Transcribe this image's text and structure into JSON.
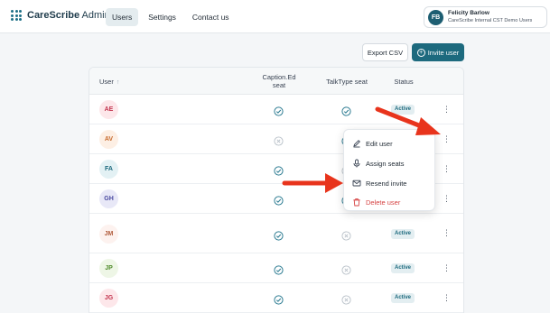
{
  "app": {
    "name": "CareScribe",
    "suffix": " Admin"
  },
  "nav": [
    {
      "label": "Users",
      "active": true
    },
    {
      "label": "Settings",
      "active": false
    },
    {
      "label": "Contact us",
      "active": false
    }
  ],
  "user": {
    "initials": "FB",
    "name": "Felicity Barlow",
    "org": "CareScribe Internal CST Demo Users"
  },
  "actions": {
    "export_label": "Export CSV",
    "invite_label": "Invite user"
  },
  "table": {
    "columns": {
      "user": "User",
      "captioned": "Caption.Ed\nseat",
      "talktype": "TalkType seat",
      "status": "Status"
    },
    "rows": [
      {
        "initials": "AE",
        "bg": "#fde7ea",
        "fg": "#c2334d",
        "captioned": true,
        "talktype": true,
        "status": "Active"
      },
      {
        "initials": "AV",
        "bg": "#fdefe4",
        "fg": "#c76a2d",
        "captioned": false,
        "talktype": true,
        "status": ""
      },
      {
        "initials": "FA",
        "bg": "#e3f1f4",
        "fg": "#1d6a7e",
        "captioned": true,
        "talktype": false,
        "status": ""
      },
      {
        "initials": "GH",
        "bg": "#e8e8f7",
        "fg": "#4a4aa0",
        "captioned": true,
        "talktype": true,
        "status": ""
      },
      {
        "initials": "JM",
        "bg": "#fdf2ef",
        "fg": "#b05a3a",
        "captioned": true,
        "talktype": false,
        "status": "Active"
      },
      {
        "initials": "JP",
        "bg": "#eef6e6",
        "fg": "#4f8a2a",
        "captioned": true,
        "talktype": false,
        "status": "Active"
      },
      {
        "initials": "JG",
        "bg": "#fde7ea",
        "fg": "#c2334d",
        "captioned": true,
        "talktype": false,
        "status": "Active"
      }
    ]
  },
  "menu": {
    "items": [
      {
        "label": "Edit user",
        "icon": "pencil-icon",
        "danger": false
      },
      {
        "label": "Assign seats",
        "icon": "microphone-icon",
        "danger": false
      },
      {
        "label": "Resend invite",
        "icon": "envelope-icon",
        "danger": false
      },
      {
        "label": "Delete user",
        "icon": "trash-icon",
        "danger": true
      }
    ]
  },
  "colors": {
    "accent": "#1d6a7e",
    "check": "#2f7d93",
    "cross": "#b8c0c8",
    "danger": "#d64545",
    "arrow": "#e8341c"
  }
}
